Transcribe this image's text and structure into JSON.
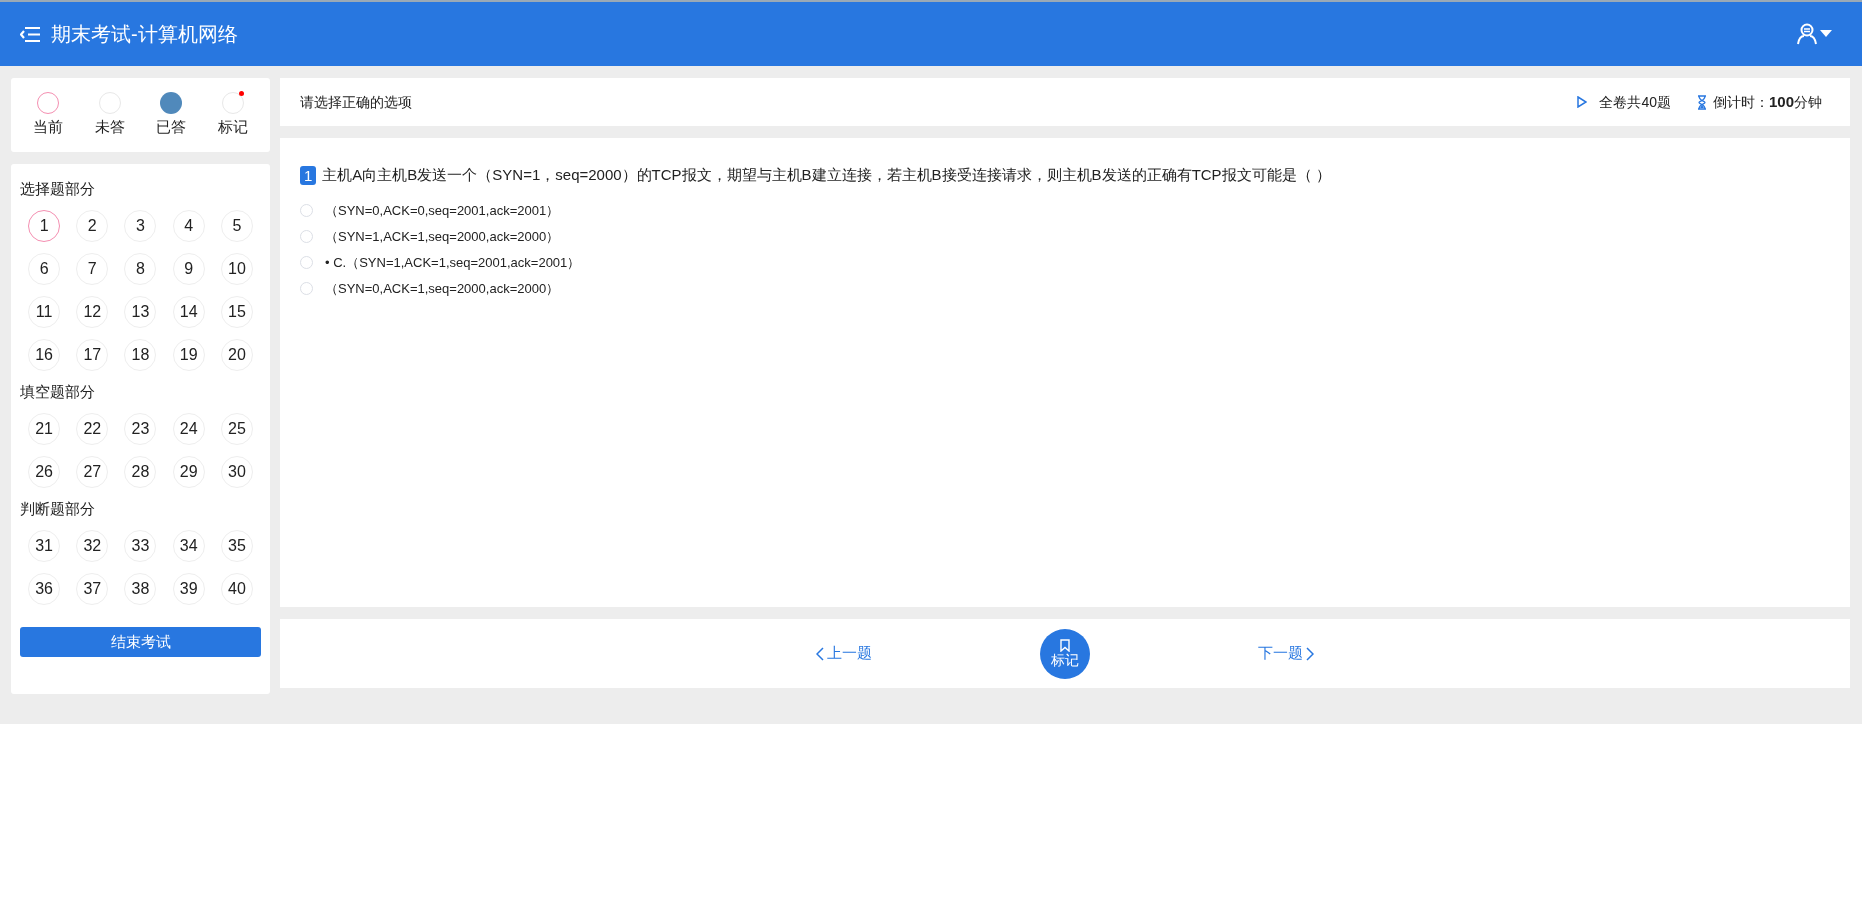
{
  "header": {
    "title": "期末考试-计算机网络"
  },
  "legend": [
    {
      "kind": "current",
      "label": "当前"
    },
    {
      "kind": "unanswered",
      "label": "未答"
    },
    {
      "kind": "answered",
      "label": "已答"
    },
    {
      "kind": "marked",
      "label": "标记"
    }
  ],
  "sections": [
    {
      "title": "选择题部分",
      "numbers": [
        {
          "label": "1",
          "selected": true
        },
        {
          "label": "2",
          "selected": false
        },
        {
          "label": "3",
          "selected": false
        },
        {
          "label": "4",
          "selected": false
        },
        {
          "label": "5",
          "selected": false
        },
        {
          "label": "6",
          "selected": false
        },
        {
          "label": "7",
          "selected": false
        },
        {
          "label": "8",
          "selected": false
        },
        {
          "label": "9",
          "selected": false
        },
        {
          "label": "10",
          "selected": false
        },
        {
          "label": "11",
          "selected": false
        },
        {
          "label": "12",
          "selected": false
        },
        {
          "label": "13",
          "selected": false
        },
        {
          "label": "14",
          "selected": false
        },
        {
          "label": "15",
          "selected": false
        },
        {
          "label": "16",
          "selected": false
        },
        {
          "label": "17",
          "selected": false
        },
        {
          "label": "18",
          "selected": false
        },
        {
          "label": "19",
          "selected": false
        },
        {
          "label": "20",
          "selected": false
        }
      ]
    },
    {
      "title": "填空题部分",
      "numbers": [
        {
          "label": "21",
          "selected": false
        },
        {
          "label": "22",
          "selected": false
        },
        {
          "label": "23",
          "selected": false
        },
        {
          "label": "24",
          "selected": false
        },
        {
          "label": "25",
          "selected": false
        },
        {
          "label": "26",
          "selected": false
        },
        {
          "label": "27",
          "selected": false
        },
        {
          "label": "28",
          "selected": false
        },
        {
          "label": "29",
          "selected": false
        },
        {
          "label": "30",
          "selected": false
        }
      ]
    },
    {
      "title": "判断题部分",
      "numbers": [
        {
          "label": "31",
          "selected": false
        },
        {
          "label": "32",
          "selected": false
        },
        {
          "label": "33",
          "selected": false
        },
        {
          "label": "34",
          "selected": false
        },
        {
          "label": "35",
          "selected": false
        },
        {
          "label": "36",
          "selected": false
        },
        {
          "label": "37",
          "selected": false
        },
        {
          "label": "38",
          "selected": false
        },
        {
          "label": "39",
          "selected": false
        },
        {
          "label": "40",
          "selected": false
        }
      ]
    }
  ],
  "finish_button": "结束考试",
  "info_bar": {
    "instruction": "请选择正确的选项",
    "total": "全卷共40题",
    "countdown_label": "倒计时：",
    "countdown_value": "100",
    "countdown_unit": "分钟"
  },
  "question": {
    "number": "1",
    "text": "主机A向主机B发送一个（SYN=1，seq=2000）的TCP报文，期望与主机B建立连接，若主机B接受连接请求，则主机B发送的正确有TCP报文可能是（ ）",
    "options": [
      {
        "text": "（SYN=0,ACK=0,seq=2001,ack=2001）",
        "selected": false
      },
      {
        "text": "（SYN=1,ACK=1,seq=2000,ack=2000）",
        "selected": false
      },
      {
        "text": "• C.（SYN=1,ACK=1,seq=2001,ack=2001）",
        "selected": false
      },
      {
        "text": "（SYN=0,ACK=1,seq=2000,ack=2000）",
        "selected": false
      }
    ]
  },
  "nav": {
    "prev": "上一题",
    "mark": "标记",
    "next": "下一题"
  }
}
